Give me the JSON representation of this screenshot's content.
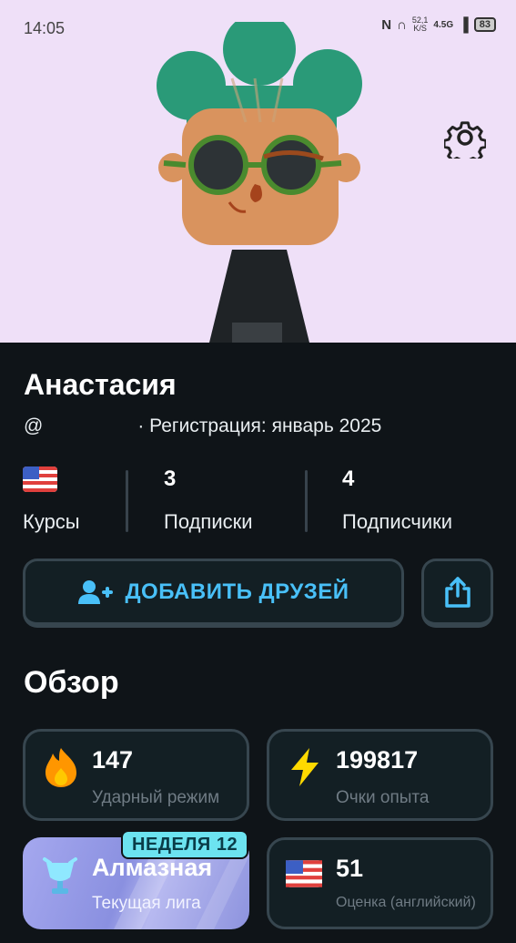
{
  "status_bar": {
    "time": "14:05",
    "nfc": "N",
    "speed_value": "52,1",
    "speed_unit": "K/S",
    "network": "4.5G",
    "battery": "83"
  },
  "profile": {
    "name": "Анастасия",
    "handle_prefix": "@",
    "registration": "· Регистрация: январь 2025",
    "stats": {
      "courses_label": "Курсы",
      "following_value": "3",
      "following_label": "Подписки",
      "followers_value": "4",
      "followers_label": "Подписчики"
    }
  },
  "actions": {
    "add_friends_label": "ДОБАВИТЬ ДРУЗЕЙ"
  },
  "overview": {
    "title": "Обзор",
    "streak_value": "147",
    "streak_label": "Ударный режим",
    "xp_value": "199817",
    "xp_label": "Очки опыта",
    "league_badge": "НЕДЕЛЯ 12",
    "league_value": "Алмазная",
    "league_label": "Текущая лига",
    "score_value": "51",
    "score_label": "Оценка (английский)"
  },
  "colors": {
    "header_bg": "#efe0f8",
    "page_bg": "#0f1418",
    "accent_blue": "#49c0f8",
    "card_border": "#37464f",
    "hair_green": "#2a9a78",
    "skin": "#d9935e"
  },
  "icons": [
    "gear-icon",
    "add-user-icon",
    "share-icon",
    "flame-icon",
    "lightning-icon",
    "diamond-trophy-icon",
    "us-flag-icon"
  ]
}
